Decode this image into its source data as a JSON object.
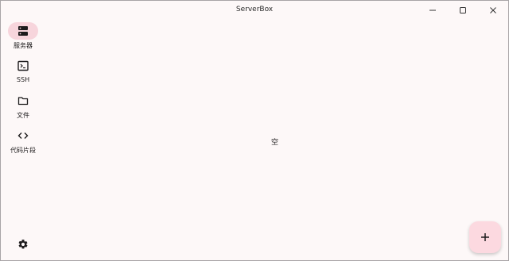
{
  "app": {
    "title": "ServerBox"
  },
  "window_controls": [
    {
      "name": "minimize-icon"
    },
    {
      "name": "maximize-icon"
    },
    {
      "name": "close-icon"
    }
  ],
  "nav": {
    "items": [
      {
        "label": "服务器",
        "icon": "server-icon",
        "active": true
      },
      {
        "label": "SSH",
        "icon": "terminal-icon",
        "active": false
      },
      {
        "label": "文件",
        "icon": "folder-icon",
        "active": false
      },
      {
        "label": "代码片段",
        "icon": "code-icon",
        "active": false
      }
    ],
    "settings_icon": "gear-icon"
  },
  "main": {
    "empty_text": "空"
  },
  "fab": {
    "icon": "plus-icon"
  },
  "colors": {
    "background": "#fdf8f8",
    "nav_active_pill": "#f7d5dc",
    "fab_background": "#fcd9e0"
  }
}
